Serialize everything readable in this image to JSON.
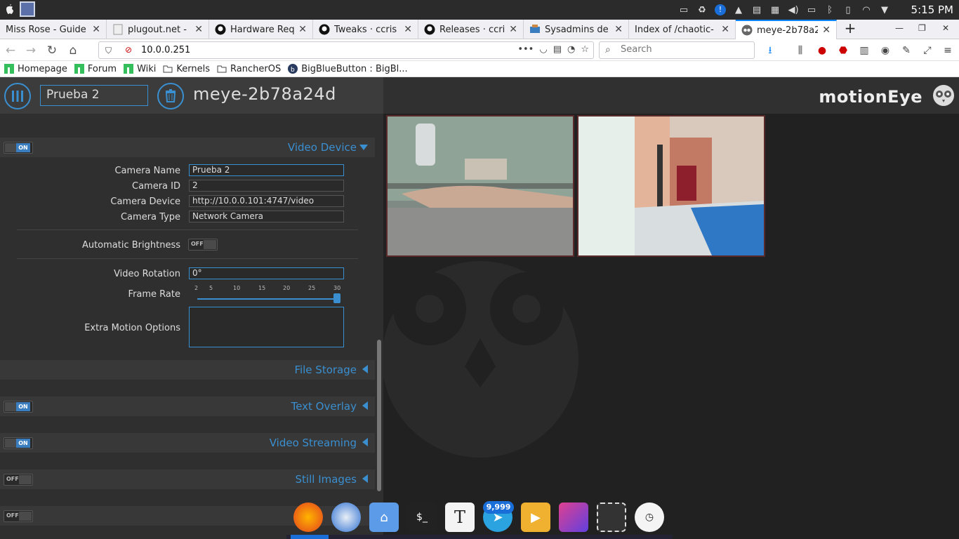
{
  "os_panel": {
    "clock": "5:15 PM",
    "tray_icons": [
      "screen-icon",
      "recycle-icon",
      "info-icon",
      "cone-icon",
      "window-icon",
      "clipboard-icon",
      "volume-icon",
      "battery-icon",
      "bluetooth-icon",
      "drive-icon",
      "wifi-icon",
      "dropdown-icon"
    ]
  },
  "tabs": [
    {
      "title": "Miss Rose - Guide",
      "favicon": "none"
    },
    {
      "title": "plugout.net - ",
      "favicon": "page-icon"
    },
    {
      "title": "Hardware Req",
      "favicon": "github-icon"
    },
    {
      "title": "Tweaks · ccris",
      "favicon": "github-icon"
    },
    {
      "title": "Releases · ccri",
      "favicon": "github-icon"
    },
    {
      "title": "Sysadmins de",
      "favicon": "sysadmin-icon"
    },
    {
      "title": "Index of /chaotic-",
      "favicon": "none"
    },
    {
      "title": "meye-2b78a24",
      "favicon": "motioneye-icon",
      "active": true
    }
  ],
  "navbar": {
    "url": "10.0.0.251",
    "search_placeholder": "Search"
  },
  "bookmarks": [
    {
      "label": "Homepage",
      "icon": "manjaro-icon"
    },
    {
      "label": "Forum",
      "icon": "manjaro-icon"
    },
    {
      "label": "Wiki",
      "icon": "manjaro-icon"
    },
    {
      "label": "Kernels",
      "icon": "folder-icon"
    },
    {
      "label": "RancherOS",
      "icon": "folder-icon"
    },
    {
      "label": "BigBlueButton : BigBl...",
      "icon": "bbb-icon"
    }
  ],
  "header": {
    "camera_select": "Prueba 2",
    "camera_title": "meye-2b78a24d",
    "brand": "motionEye"
  },
  "settings": {
    "video_device": {
      "title": "Video Device",
      "toggle": "ON",
      "camera_name_label": "Camera Name",
      "camera_name": "Prueba 2",
      "camera_id_label": "Camera ID",
      "camera_id": "2",
      "camera_device_label": "Camera Device",
      "camera_device": "http://10.0.0.101:4747/video",
      "camera_type_label": "Camera Type",
      "camera_type": "Network Camera",
      "auto_brightness_label": "Automatic Brightness",
      "auto_brightness": "OFF",
      "rotation_label": "Video Rotation",
      "rotation": "0°",
      "frame_rate_label": "Frame Rate",
      "frame_rate_ticks": [
        "2",
        "5",
        "10",
        "15",
        "20",
        "25",
        "30"
      ],
      "frame_rate_value": 30,
      "extra_motion_label": "Extra Motion Options",
      "extra_motion_value": ""
    },
    "sections": [
      {
        "title": "File Storage",
        "toggle": null
      },
      {
        "title": "Text Overlay",
        "toggle": "ON"
      },
      {
        "title": "Video Streaming",
        "toggle": "ON"
      },
      {
        "title": "Still Images",
        "toggle": "OFF"
      },
      {
        "title": "",
        "toggle": "OFF"
      }
    ]
  },
  "cameras": [
    {
      "label": "camera-1-frame"
    },
    {
      "label": "camera-2-frame"
    }
  ],
  "dock": {
    "badge": "9,999",
    "items": [
      "firefox-icon",
      "thunderbird-icon",
      "home-folder-icon",
      "terminal-icon",
      "typora-icon",
      "telegram-icon",
      "media-player-icon",
      "gradient-app-icon",
      "screenshot-icon",
      "clock-icon"
    ]
  },
  "colors": {
    "accent": "#3a8fd0",
    "panel_bg": "#2f2f2f",
    "main_bg": "#212121"
  }
}
